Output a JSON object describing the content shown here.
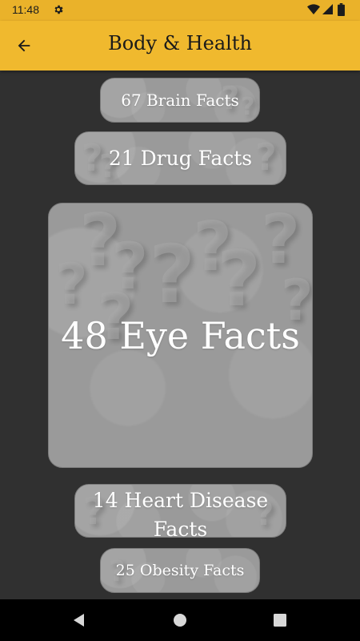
{
  "status_bar": {
    "time": "11:48"
  },
  "app_bar": {
    "title": "Body & Health"
  },
  "cards": {
    "brain": "67 Brain Facts",
    "drug": "21 Drug Facts",
    "eye": "48 Eye Facts",
    "heart": "14 Heart Disease Facts",
    "obesity": "25 Obesity Facts"
  },
  "colors": {
    "app_bar": "#f0b92e",
    "status_bar": "#eab22a",
    "background": "#303030",
    "card": "#9a9a9a",
    "card_text": "#ffffff"
  }
}
